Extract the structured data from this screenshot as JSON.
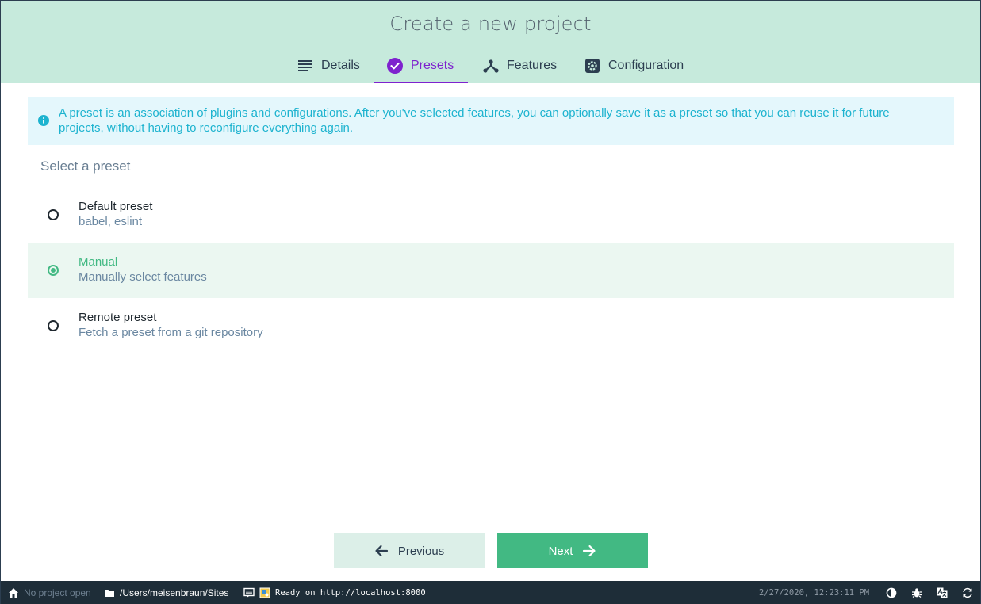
{
  "header": {
    "title": "Create a new project",
    "tabs": [
      {
        "label": "Details",
        "icon": "list-icon"
      },
      {
        "label": "Presets",
        "icon": "check-circle-icon",
        "active": true
      },
      {
        "label": "Features",
        "icon": "fork-icon"
      },
      {
        "label": "Configuration",
        "icon": "settings-icon"
      }
    ],
    "accent_color": "#7e22ce"
  },
  "info": {
    "text": "A preset is an association of plugins and configurations. After you've selected features, you can optionally save it as a preset so that you can reuse it for future projects, without having to reconfigure everything again."
  },
  "presets": {
    "title": "Select a preset",
    "options": [
      {
        "name": "Default preset",
        "description": "babel, eslint",
        "selected": false
      },
      {
        "name": "Manual",
        "description": "Manually select features",
        "selected": true
      },
      {
        "name": "Remote preset",
        "description": "Fetch a preset from a git repository",
        "selected": false
      }
    ]
  },
  "buttons": {
    "previous": "Previous",
    "next": "Next",
    "primary_color": "#42b983"
  },
  "statusbar": {
    "project": "No project open",
    "cwd": "/Users/meisenbraun/Sites",
    "log": "Ready on http://localhost:8000",
    "datetime": "2/27/2020, 12:23:11 PM"
  }
}
